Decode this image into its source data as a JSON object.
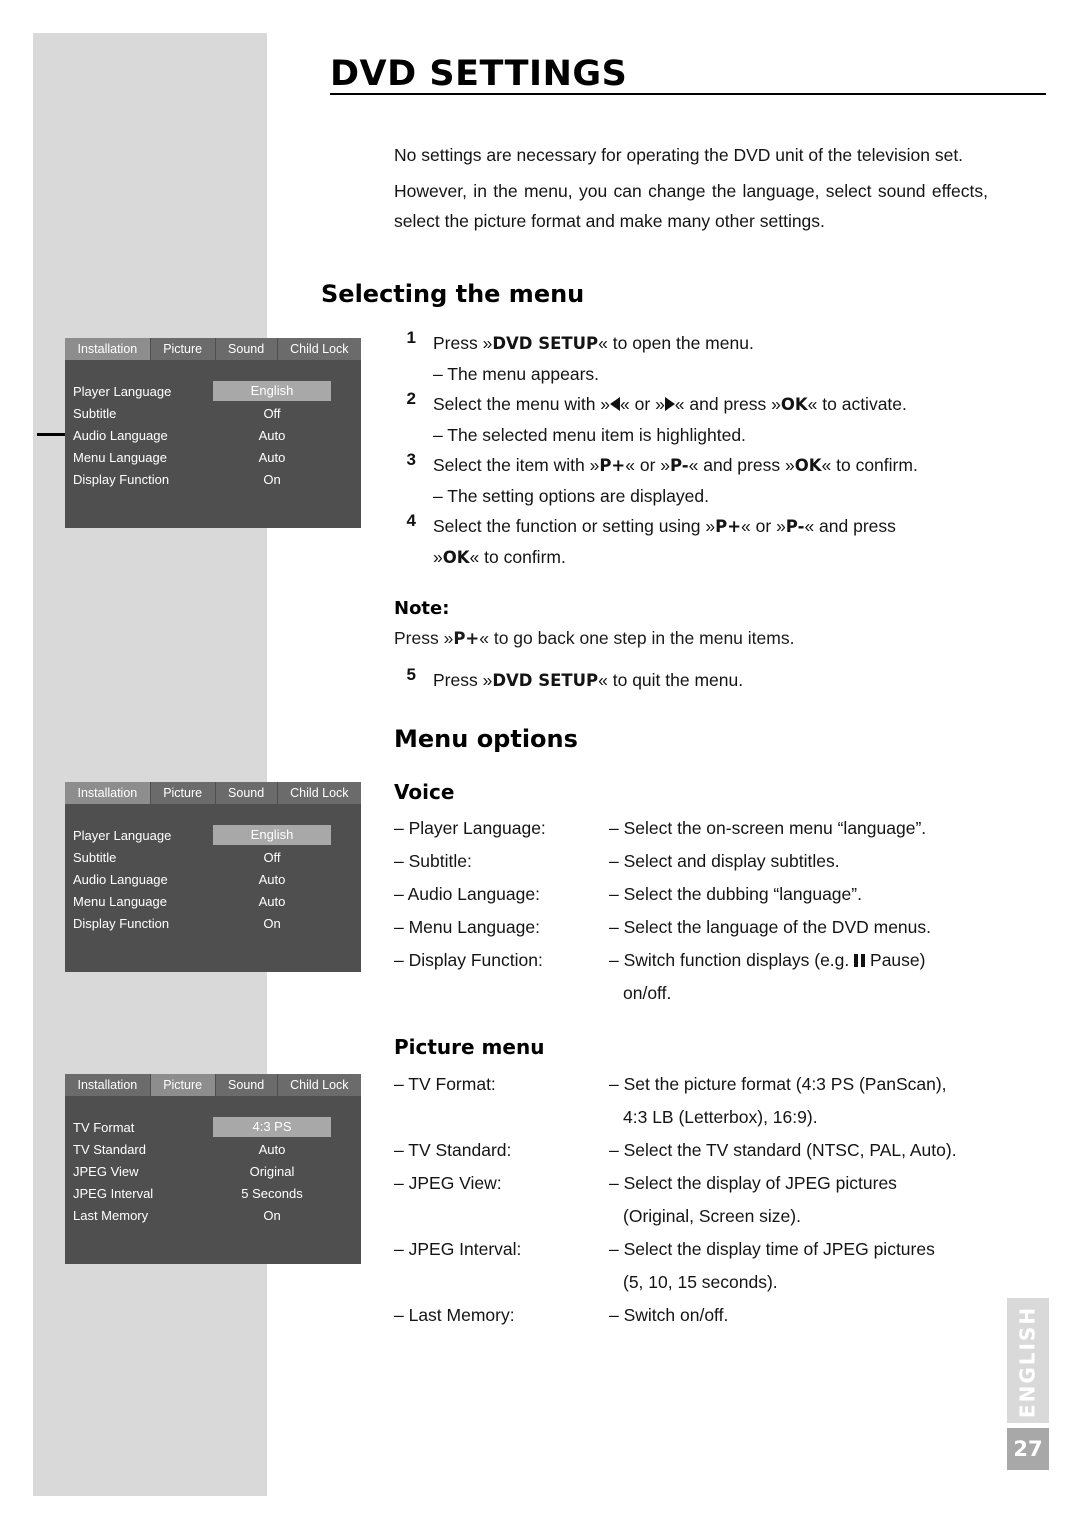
{
  "header": {
    "title": "DVD SETTINGS"
  },
  "intro": {
    "p1": "No settings are necessary for operating the DVD unit of the tele­vision set.",
    "p2": "However, in the menu, you can change the language, select sound effects, select the picture format and make many other settings."
  },
  "sections": {
    "selecting_the_menu": "Selecting the menu",
    "menu_options": "Menu options",
    "voice": "Voice",
    "picture_menu": "Picture menu"
  },
  "steps": [
    {
      "num": "1",
      "text_pre": "Press »",
      "bold": "DVD SETUP",
      "text_post": "« to open the menu.",
      "dash": "– The menu appears."
    },
    {
      "num": "2",
      "dash": "– The selected menu item is highlighted."
    },
    {
      "num": "3",
      "dash": "– The setting options are displayed."
    },
    {
      "num": "4",
      "dash": ""
    }
  ],
  "step_text": {
    "s2_a": "Select the menu with »",
    "s2_b": "« or »",
    "s2_c": "« and press »",
    "s2_ok": "OK",
    "s2_d": "« to activate.",
    "s3_a": "Select the item with »",
    "s3_pplus": "P+",
    "s3_b": "« or »",
    "s3_pminus": "P-",
    "s3_c": "« and press »",
    "s3_ok": "OK",
    "s3_d": "« to confirm.",
    "s4_a": "Select the function or setting using »",
    "s4_pplus": "P+",
    "s4_b": "« or »",
    "s4_pminus": "P-",
    "s4_c": "« and press",
    "s4_d": "»",
    "s4_ok": "OK",
    "s4_e": "« to confirm.",
    "s5_num": "5",
    "s5_a": "Press »",
    "s5_bold": "DVD SETUP",
    "s5_b": "« to quit the menu."
  },
  "note": {
    "title": "Note:",
    "a": "Press »",
    "bold": "P+",
    "b": "« to go back one step in the menu items."
  },
  "voice_list": [
    {
      "term": "– Player Language:",
      "desc": "– Select the on‑screen menu “language”."
    },
    {
      "term": "– Subtitle:",
      "desc": "– Select and display subtitles."
    },
    {
      "term": "– Audio Language:",
      "desc": "– Select the dubbing “language”."
    },
    {
      "term": "– Menu Language:",
      "desc": "– Select the language of the DVD menus."
    },
    {
      "term": "– Display Function:",
      "desc": "– Switch function displays (e.g.",
      "desc_tail": "Pause)",
      "cont": "on/off."
    }
  ],
  "picture_list": [
    {
      "term": "– TV Format:",
      "desc": "– Set the picture format (4:3 PS (PanScan),",
      "cont": "4:3 LB (Letterbox), 16:9)."
    },
    {
      "term": "– TV Standard:",
      "desc": "– Select the TV standard (NTSC, PAL, Auto)."
    },
    {
      "term": "– JPEG View:",
      "desc": "– Select the display of JPEG pictures",
      "cont": "(Original, Screen size)."
    },
    {
      "term": "– JPEG Interval:",
      "desc": "– Select the display time of JPEG pictures",
      "cont": "(5, 10, 15 seconds)."
    },
    {
      "term": "– Last Memory:",
      "desc": "– Switch on/off."
    }
  ],
  "osd_menus": [
    {
      "id": "installation-menu-1",
      "tabs": [
        "Installation",
        "Picture",
        "Sound",
        "Child Lock"
      ],
      "active_tab": "Installation",
      "rows": [
        {
          "label": "Player Language",
          "value": "English",
          "selected": true
        },
        {
          "label": "Subtitle",
          "value": "Off",
          "selected": false
        },
        {
          "label": "Audio Language",
          "value": "Auto",
          "selected": false
        },
        {
          "label": "Menu Language",
          "value": "Auto",
          "selected": false
        },
        {
          "label": "Display Function",
          "value": "On",
          "selected": false
        }
      ]
    },
    {
      "id": "installation-menu-2",
      "tabs": [
        "Installation",
        "Picture",
        "Sound",
        "Child Lock"
      ],
      "active_tab": "Installation",
      "rows": [
        {
          "label": "Player Language",
          "value": "English",
          "selected": true
        },
        {
          "label": "Subtitle",
          "value": "Off",
          "selected": false
        },
        {
          "label": "Audio Language",
          "value": "Auto",
          "selected": false
        },
        {
          "label": "Menu Language",
          "value": "Auto",
          "selected": false
        },
        {
          "label": "Display Function",
          "value": "On",
          "selected": false
        }
      ]
    },
    {
      "id": "picture-menu",
      "tabs": [
        "Installation",
        "Picture",
        "Sound",
        "Child Lock"
      ],
      "active_tab": "Picture",
      "rows": [
        {
          "label": "TV Format",
          "value": "4:3 PS",
          "selected": true
        },
        {
          "label": "TV Standard",
          "value": "Auto",
          "selected": false
        },
        {
          "label": "JPEG View",
          "value": "Original",
          "selected": false
        },
        {
          "label": "JPEG Interval",
          "value": "5 Seconds",
          "selected": false
        },
        {
          "label": "Last Memory",
          "value": "On",
          "selected": false
        }
      ]
    }
  ],
  "footer": {
    "language_tab": "ENGLISH",
    "page_number": "27"
  },
  "colors": {
    "band": "#d9d9d9",
    "osd_bg": "#4f4f4f",
    "osd_tabbar": "#6b6b6b",
    "osd_tab_active": "#8d8d8d",
    "osd_highlight": "#a8a8a8",
    "page_num_bg": "#a8a8a8"
  }
}
